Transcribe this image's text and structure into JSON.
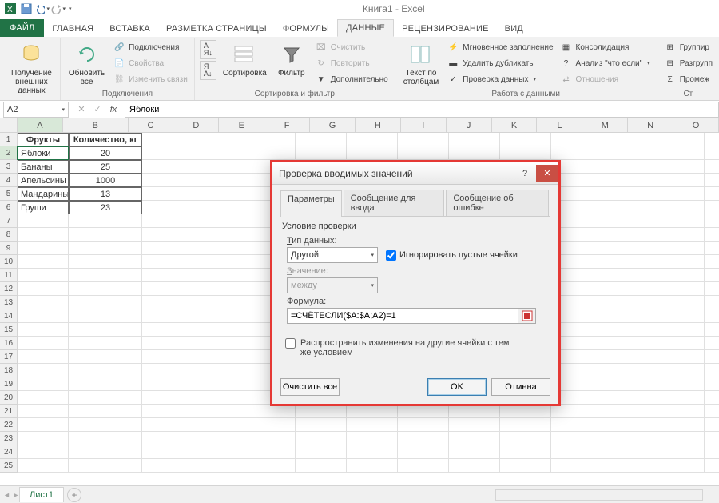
{
  "app": {
    "title": "Книга1 - Excel"
  },
  "qat": {
    "save": "save-icon",
    "undo": "undo-icon",
    "redo": "redo-icon"
  },
  "tabs": {
    "file": "ФАЙЛ",
    "list": [
      "ГЛАВНАЯ",
      "ВСТАВКА",
      "РАЗМЕТКА СТРАНИЦЫ",
      "ФОРМУЛЫ",
      "ДАННЫЕ",
      "РЕЦЕНЗИРОВАНИЕ",
      "ВИД"
    ],
    "active_index": 4
  },
  "ribbon": {
    "g1": {
      "get_data": "Получение\nвнешних данных",
      "label": ""
    },
    "g2": {
      "refresh": "Обновить\nвсе",
      "connections": "Подключения",
      "properties": "Свойства",
      "edit_links": "Изменить связи",
      "label": "Подключения"
    },
    "g3": {
      "sort_az": "A↓Я",
      "sort_za": "Я↓A",
      "sort": "Сортировка",
      "filter": "Фильтр",
      "clear": "Очистить",
      "reapply": "Повторить",
      "advanced": "Дополнительно",
      "label": "Сортировка и фильтр"
    },
    "g4": {
      "text_to_col": "Текст по\nстолбцам",
      "flash_fill": "Мгновенное заполнение",
      "remove_dup": "Удалить дубликаты",
      "data_val": "Проверка данных",
      "consolidate": "Консолидация",
      "whatif": "Анализ \"что если\"",
      "relationships": "Отношения",
      "label": "Работа с данными"
    },
    "g5": {
      "group": "Группир",
      "ungroup": "Разгрупп",
      "subtotal": "Промеж",
      "label": "Ст"
    }
  },
  "namebox": "A2",
  "formula": "Яблоки",
  "columns": [
    "A",
    "B",
    "C",
    "D",
    "E",
    "F",
    "G",
    "H",
    "I",
    "J",
    "K",
    "L",
    "M",
    "N",
    "O"
  ],
  "table": {
    "headers": [
      "Фрукты",
      "Количество, кг"
    ],
    "rows": [
      [
        "Яблоки",
        "20"
      ],
      [
        "Бананы",
        "25"
      ],
      [
        "Апельсины",
        "1000"
      ],
      [
        "Мандарины",
        "13"
      ],
      [
        "Груши",
        "23"
      ]
    ]
  },
  "sheet_tab": "Лист1",
  "dialog": {
    "title": "Проверка вводимых значений",
    "tabs": [
      "Параметры",
      "Сообщение для ввода",
      "Сообщение об ошибке"
    ],
    "section": "Условие проверки",
    "type_label": "Тип данных:",
    "type_value": "Другой",
    "ignore_blank": "Игнорировать пустые ячейки",
    "value_label": "Значение:",
    "value_value": "между",
    "formula_label": "Формула:",
    "formula_value": "=СЧЁТЕСЛИ($A:$A;A2)=1",
    "propagate": "Распространить изменения на другие ячейки с тем же условием",
    "clear_all": "Очистить все",
    "ok": "OK",
    "cancel": "Отмена"
  }
}
